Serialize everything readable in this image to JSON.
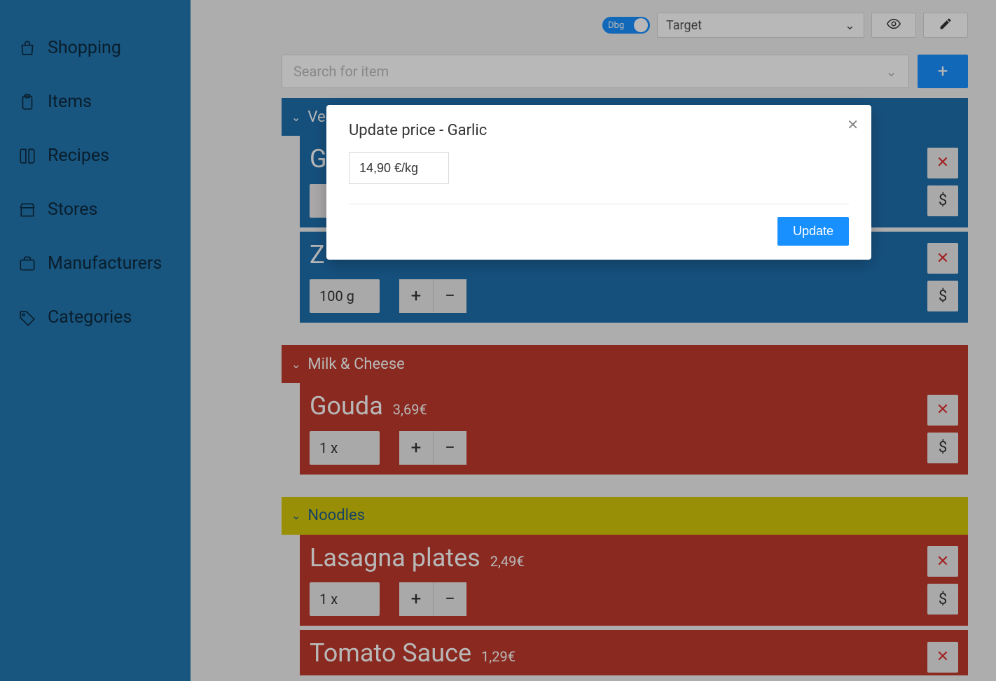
{
  "sidebar": {
    "items": [
      {
        "label": "Shopping",
        "icon": "shopping-bag-icon"
      },
      {
        "label": "Items",
        "icon": "clipboard-icon"
      },
      {
        "label": "Recipes",
        "icon": "book-icon"
      },
      {
        "label": "Stores",
        "icon": "storefront-icon"
      },
      {
        "label": "Manufacturers",
        "icon": "briefcase-icon"
      },
      {
        "label": "Categories",
        "icon": "tag-icon"
      }
    ]
  },
  "topbar": {
    "debug_label": "Dbg",
    "store": "Target"
  },
  "search": {
    "placeholder": "Search for item"
  },
  "sections": [
    {
      "name": "Vegetables",
      "color": "blue",
      "items": [
        {
          "name": "G",
          "price": "",
          "qty": ""
        },
        {
          "name": "Z",
          "price": "",
          "qty": "100 g"
        }
      ]
    },
    {
      "name": "Milk & Cheese",
      "color": "red",
      "items": [
        {
          "name": "Gouda",
          "price": "3,69€",
          "qty": "1 x"
        }
      ]
    },
    {
      "name": "Noodles",
      "color": "yellow",
      "items": [
        {
          "name": "Lasagna plates",
          "price": "2,49€",
          "qty": "1 x"
        },
        {
          "name": "Tomato Sauce",
          "price": "1,29€",
          "qty": ""
        }
      ]
    }
  ],
  "modal": {
    "title": "Update price - Garlic",
    "price_value": "14,90 €/kg",
    "update_label": "Update"
  },
  "glyphs": {
    "plus": "+",
    "minus": "−",
    "x": "✕",
    "dollar": "$",
    "chev_down": "⌄",
    "eye": "👁",
    "pencil": "✎"
  }
}
